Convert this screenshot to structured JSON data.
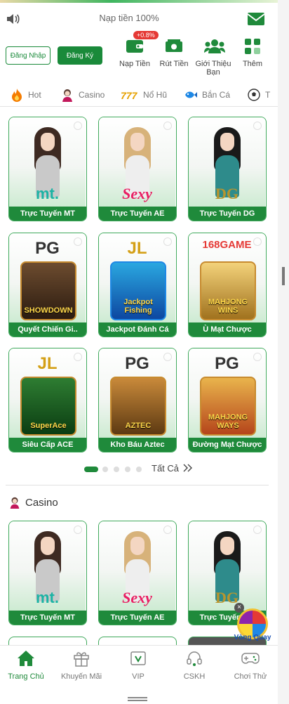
{
  "colors": {
    "brand_green": "#1f8a3b",
    "accent_red": "#e53935",
    "muted_text": "#777777"
  },
  "notice": {
    "text": "Nạp tiền 100%",
    "icon_left": "speaker-icon",
    "icon_right": "mail-icon"
  },
  "auth": {
    "login_label": "Đăng Nhập",
    "register_label": "Đăng Ký"
  },
  "quick_actions": [
    {
      "label": "Nạp Tiền",
      "icon": "wallet-icon",
      "badge": "+0.8%"
    },
    {
      "label": "Rút Tiền",
      "icon": "cash-icon"
    },
    {
      "label": "Giới Thiệu Bạn",
      "icon": "friends-icon"
    },
    {
      "label": "Thêm",
      "icon": "more-grid-icon"
    }
  ],
  "tabs": [
    {
      "label": "Hot",
      "icon": "flame-icon"
    },
    {
      "label": "Casino",
      "icon": "dealer-icon"
    },
    {
      "label": "Nổ Hũ",
      "icon": "slot-777-icon"
    },
    {
      "label": "Bắn Cá",
      "icon": "fish-icon"
    },
    {
      "label": "T",
      "icon": "soccer-ball-icon"
    }
  ],
  "hot_games": [
    {
      "name": "Trực Tuyến MT",
      "brand": "mt."
    },
    {
      "name": "Trực Tuyến AE",
      "brand": "Sexy"
    },
    {
      "name": "Trực Tuyến DG",
      "brand": "DG"
    },
    {
      "name": "Quyết Chiến Gi..",
      "brand": "PG",
      "art_text": "SHOWDOWN"
    },
    {
      "name": "Jackpot Đánh Cá",
      "brand": "JL",
      "art_text": "Jackpot Fishing"
    },
    {
      "name": "Ù Mạt Chược",
      "brand": "168GAME",
      "art_text": "MAHJONG WINS"
    },
    {
      "name": "Siêu Cấp ACE",
      "brand": "JL",
      "art_text": "SuperAce"
    },
    {
      "name": "Kho Báu Aztec",
      "brand": "PG",
      "art_text": "AZTEC"
    },
    {
      "name": "Đường Mạt Chược",
      "brand": "PG",
      "art_text": "MAHJONG WAYS"
    }
  ],
  "pager": {
    "total": 5,
    "active": 1,
    "see_all": "Tất Cả"
  },
  "casino_section": {
    "title": "Casino",
    "games": [
      {
        "name": "Trực Tuyến MT",
        "brand": "mt."
      },
      {
        "name": "Trực Tuyến AE",
        "brand": "Sexy"
      },
      {
        "name": "Trực Tuyến DG",
        "brand": "DG"
      }
    ]
  },
  "wheel": {
    "label": "Vòng Quay",
    "close": "×"
  },
  "bottom_nav": [
    {
      "label": "Trang Chủ",
      "icon": "home-icon",
      "active": true
    },
    {
      "label": "Khuyến Mãi",
      "icon": "gift-icon"
    },
    {
      "label": "VIP",
      "icon": "vip-icon"
    },
    {
      "label": "CSKH",
      "icon": "headset-icon"
    },
    {
      "label": "Chơi Thử",
      "icon": "gamepad-icon"
    }
  ]
}
